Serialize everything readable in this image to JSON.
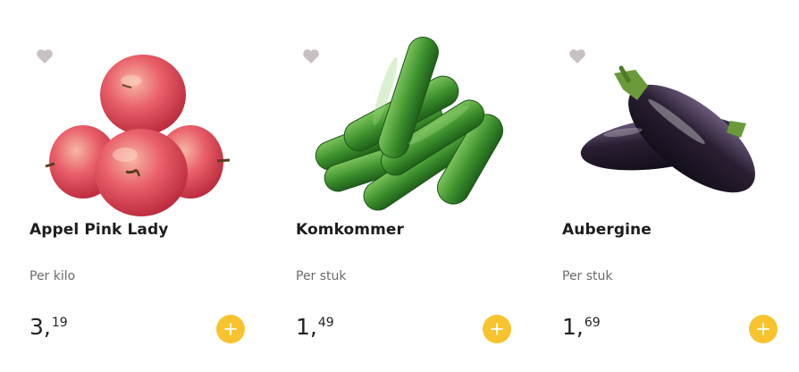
{
  "colors": {
    "accent": "#f7c42f",
    "heart": "#c8c0c4",
    "title": "#1c1c1c",
    "muted": "#6b6b6b"
  },
  "products": [
    {
      "name": "Appel Pink Lady",
      "unit": "Per kilo",
      "price_euros": "3",
      "price_sep": ",",
      "price_cents": "19",
      "image_icon": "apple-image",
      "favorite_icon": "heart-icon",
      "add_icon": "plus-icon"
    },
    {
      "name": "Komkommer",
      "unit": "Per stuk",
      "price_euros": "1",
      "price_sep": ",",
      "price_cents": "49",
      "image_icon": "cucumber-image",
      "favorite_icon": "heart-icon",
      "add_icon": "plus-icon"
    },
    {
      "name": "Aubergine",
      "unit": "Per stuk",
      "price_euros": "1",
      "price_sep": ",",
      "price_cents": "69",
      "image_icon": "eggplant-image",
      "favorite_icon": "heart-icon",
      "add_icon": "plus-icon"
    }
  ]
}
